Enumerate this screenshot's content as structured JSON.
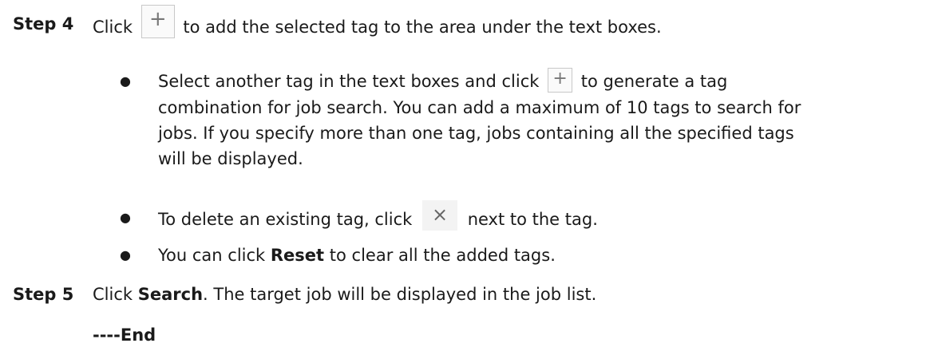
{
  "step4": {
    "label": "Step 4",
    "text_before": "Click",
    "text_after": "to add the selected tag to the area under the text boxes."
  },
  "bullets": [
    {
      "before": "Select another tag in the text boxes and click",
      "after_line1": "to generate a tag",
      "line2": "combination for job search. You can add a maximum of 10 tags to search for",
      "line3": "jobs. If you specify more than one tag, jobs containing all the specified tags",
      "line4": "will be displayed."
    },
    {
      "before": "To delete an existing tag, click",
      "after": "next to the tag."
    },
    {
      "before": "You can click",
      "bold": "Reset",
      "after": "to clear all the added tags."
    }
  ],
  "step5": {
    "label": "Step 5",
    "text_before": "Click",
    "bold": "Search",
    "text_after": ". The target job will be displayed in the job list."
  },
  "end_marker": "----End",
  "icons": {
    "plus": "+",
    "close": "×",
    "bullet": "●"
  }
}
